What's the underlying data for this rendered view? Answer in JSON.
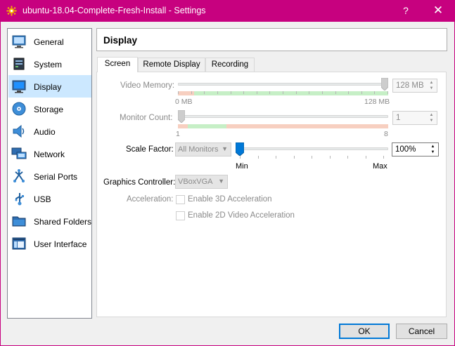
{
  "window": {
    "title": "ubuntu-18.04-Complete-Fresh-Install - Settings",
    "help_label": "?",
    "close_label": "✕"
  },
  "sidebar": {
    "items": [
      {
        "label": "General",
        "icon": "general-icon"
      },
      {
        "label": "System",
        "icon": "system-icon"
      },
      {
        "label": "Display",
        "icon": "display-icon",
        "selected": true
      },
      {
        "label": "Storage",
        "icon": "storage-icon"
      },
      {
        "label": "Audio",
        "icon": "audio-icon"
      },
      {
        "label": "Network",
        "icon": "network-icon"
      },
      {
        "label": "Serial Ports",
        "icon": "serial-ports-icon"
      },
      {
        "label": "USB",
        "icon": "usb-icon"
      },
      {
        "label": "Shared Folders",
        "icon": "shared-folders-icon"
      },
      {
        "label": "User Interface",
        "icon": "user-interface-icon"
      }
    ]
  },
  "section": {
    "title": "Display"
  },
  "tabs": [
    {
      "label": "Screen",
      "active": true
    },
    {
      "label": "Remote Display"
    },
    {
      "label": "Recording"
    }
  ],
  "screen": {
    "video_memory": {
      "label": "Video Memory:",
      "value": "128 MB",
      "min_label": "0 MB",
      "max_label": "128 MB",
      "level": 1.0
    },
    "monitor_count": {
      "label": "Monitor Count:",
      "value": "1",
      "min_label": "1",
      "max_label": "8",
      "level": 0.0
    },
    "scale_factor": {
      "label": "Scale Factor:",
      "monitor_select": "All Monitors",
      "value": "100%",
      "min_label": "Min",
      "max_label": "Max",
      "level": 0.0
    },
    "graphics_controller": {
      "label": "Graphics Controller:",
      "value": "VBoxVGA"
    },
    "acceleration": {
      "label": "Acceleration:",
      "enable_3d_label": "Enable 3D Acceleration",
      "enable_2d_label": "Enable 2D Video Acceleration"
    }
  },
  "buttons": {
    "ok": "OK",
    "cancel": "Cancel"
  },
  "colors": {
    "titlebar": "#c7017f",
    "selection": "#cce8ff",
    "accent": "#0078d7",
    "bar_green": "#c6efc6",
    "bar_red": "#f7cfc0"
  }
}
